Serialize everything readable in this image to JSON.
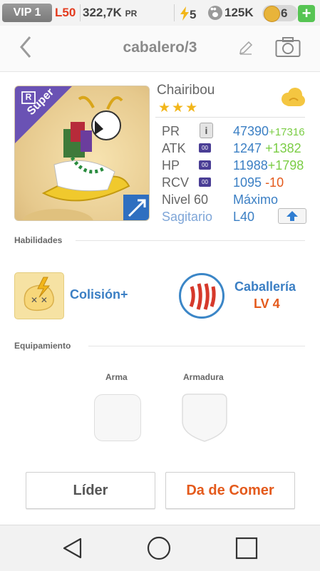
{
  "topbar": {
    "vip_label": "VIP 1",
    "level": "L50",
    "pr_value": "322,7K",
    "pr_unit": "PR",
    "energy": "5",
    "paws": "125K",
    "coins": "6",
    "plus_label": "+"
  },
  "header": {
    "title": "cabalero/3"
  },
  "monster": {
    "rarity_badge": "R",
    "tier_ribbon": "Super",
    "name": "Chairibou",
    "stars": "★★★",
    "stats": [
      {
        "label": "PR",
        "badge": "i",
        "value": "47390",
        "bonus": "+17316"
      },
      {
        "label": "ATK",
        "badge": "00",
        "value": "1247",
        "bonus": "+1382"
      },
      {
        "label": "HP",
        "badge": "00",
        "value": "11988",
        "bonus": "+1798"
      },
      {
        "label": "RCV",
        "badge": "00",
        "value": "1095",
        "bonus": "-10"
      }
    ],
    "level_label": "Nivel 60",
    "level_value": "Máximo",
    "sign_label": "Sagitario",
    "sign_value": "L40"
  },
  "skills": {
    "section_label": "Habilidades",
    "active_name": "Colisión+",
    "passive_name": "Caballería",
    "passive_level": "LV 4"
  },
  "equipment": {
    "section_label": "Equipamiento",
    "weapon_label": "Arma",
    "armor_label": "Armadura"
  },
  "actions": {
    "leader_label": "Líder",
    "feed_label": "Da de Comer"
  },
  "colors": {
    "accent_blue": "#3b7fc4",
    "accent_orange": "#e45a1c",
    "bonus_green": "#7bcd45",
    "star_gold": "#f2b61a"
  }
}
